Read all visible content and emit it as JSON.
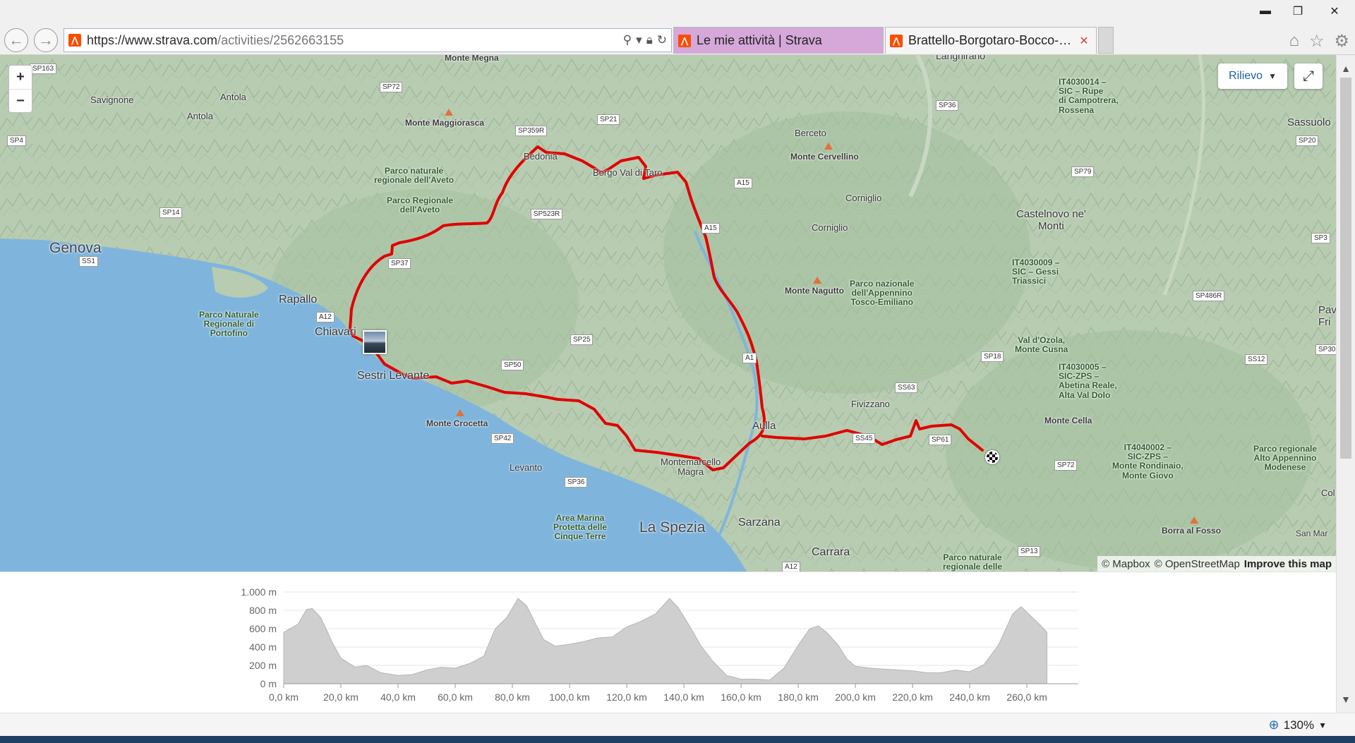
{
  "browser": {
    "url_host": "https://www.strava.com",
    "url_path": "/activities/2562663155",
    "tabs": [
      {
        "title": "Le mie attività | Strava"
      },
      {
        "title": "Brattello-Borgotaro-Bocco-C..."
      }
    ],
    "zoom": "130%"
  },
  "map": {
    "relief_label": "Rilievo",
    "zoom_in": "+",
    "zoom_out": "−",
    "attribution": [
      "© Mapbox",
      "© OpenStreetMap",
      "Improve this map"
    ],
    "labels": {
      "monte_megna": "Monte Megna",
      "savignone": "Savignone",
      "antola_1": "Antola",
      "antola_2": "Antola",
      "monte_maggiorasca": "Monte Maggiorasca",
      "bedonia": "Bedonia",
      "borgo_val_di_taro": "Borgo Val di Taro",
      "parco_aveto_1": "Parco naturale\nregionale dell'Aveto",
      "parco_aveto_2": "Parco Regionale\ndell'Aveto",
      "genova": "Genova",
      "rapallo": "Rapallo",
      "chiavari": "Chiavari",
      "parco_portofino": "Parco Naturale\nRegionale di\nPortofino",
      "sestri_levante": "Sestri Levante",
      "monte_crocetta": "Monte Crocetta",
      "levanto": "Levanto",
      "area_marina": "Area Marina\nProtetta delle\nCinque Terre",
      "la_spezia": "La Spezia",
      "sarzana": "Sarzana",
      "carrara": "Carrara",
      "montemarcello_magra": "Montemarcello\nMagra",
      "aulla": "Aulla",
      "fivizzano": "Fivizzano",
      "langhirano": "Langhirano",
      "berceto": "Berceto",
      "monte_cervellino": "Monte Cervellino",
      "corniglio_1": "Corniglio",
      "corniglio_2": "Corniglio",
      "monte_nagutto": "Monte Nagutto",
      "parco_appennino": "Parco nazionale\ndell'Appennino\nTosco-Emiliano",
      "castelnovo": "Castelnovo ne'\nMonti",
      "sic_rupe": "IT4030014 –\nSIC – Rupe\ndi Campotrera,\nRossena",
      "sic_gessi": "IT4030009 –\nSIC – Gessi\nTriassici",
      "val_dozola": "Val d'Ozola,\nMonte Cusna",
      "sic_zps": "IT4030005 –\nSIC-ZPS –\nAbetina Reale,\nAlta Val Dolo",
      "monte_cella": "Monte Cella",
      "sic_zps_2": "IT4040002 –\nSIC-ZPS –\nMonte Rondinaio,\nMonte Giovo",
      "parco_alto_appennino": "Parco regionale\nAlto Appennino\nModenese",
      "borra_al_fosso": "Borra al Fosso",
      "parco_naturale_delle": "Parco naturale\nregionale delle",
      "sassuolo": "Sassuolo",
      "pavullo": "Pav\nFri",
      "col": "Col",
      "san_marco": "San Mar"
    },
    "roads": [
      "SP163",
      "SP72",
      "SP4",
      "SP359R",
      "SP21",
      "SP36",
      "SP20",
      "SP14",
      "SS1",
      "SP37",
      "SP523R",
      "A15",
      "SP79",
      "A15",
      "SP3",
      "A12",
      "SP25",
      "SP50",
      "A1",
      "SP486R",
      "SP18",
      "SS12",
      "SP30",
      "SS63",
      "SP42",
      "SS45",
      "SP36",
      "SP72",
      "SP13",
      "A12",
      "SP61"
    ]
  },
  "elevation": {
    "y_ticks": [
      "1.000 m",
      "800 m",
      "600 m",
      "400 m",
      "200 m",
      "0 m"
    ],
    "x_ticks": [
      "0,0 km",
      "20,0 km",
      "40,0 km",
      "60,0 km",
      "80,0 km",
      "100,0 km",
      "120,0 km",
      "140,0 km",
      "160,0 km",
      "180,0 km",
      "200,0 km",
      "220,0 km",
      "240,0 km",
      "260,0 km"
    ],
    "profile": [
      [
        0,
        560
      ],
      [
        5,
        650
      ],
      [
        8,
        810
      ],
      [
        10,
        820
      ],
      [
        13,
        720
      ],
      [
        17,
        450
      ],
      [
        20,
        280
      ],
      [
        25,
        180
      ],
      [
        29,
        200
      ],
      [
        34,
        120
      ],
      [
        40,
        90
      ],
      [
        45,
        100
      ],
      [
        50,
        150
      ],
      [
        55,
        180
      ],
      [
        60,
        170
      ],
      [
        65,
        220
      ],
      [
        70,
        300
      ],
      [
        74,
        600
      ],
      [
        78,
        720
      ],
      [
        82,
        930
      ],
      [
        85,
        850
      ],
      [
        88,
        660
      ],
      [
        91,
        480
      ],
      [
        95,
        410
      ],
      [
        100,
        430
      ],
      [
        105,
        460
      ],
      [
        110,
        500
      ],
      [
        115,
        510
      ],
      [
        120,
        620
      ],
      [
        125,
        680
      ],
      [
        130,
        760
      ],
      [
        135,
        930
      ],
      [
        138,
        830
      ],
      [
        142,
        630
      ],
      [
        146,
        410
      ],
      [
        150,
        250
      ],
      [
        155,
        90
      ],
      [
        160,
        50
      ],
      [
        165,
        50
      ],
      [
        170,
        40
      ],
      [
        175,
        170
      ],
      [
        180,
        420
      ],
      [
        184,
        600
      ],
      [
        187,
        630
      ],
      [
        190,
        560
      ],
      [
        194,
        420
      ],
      [
        197,
        270
      ],
      [
        200,
        190
      ],
      [
        205,
        170
      ],
      [
        210,
        160
      ],
      [
        215,
        150
      ],
      [
        220,
        140
      ],
      [
        225,
        120
      ],
      [
        230,
        120
      ],
      [
        235,
        150
      ],
      [
        240,
        130
      ],
      [
        245,
        210
      ],
      [
        250,
        420
      ],
      [
        255,
        760
      ],
      [
        258,
        840
      ],
      [
        262,
        720
      ],
      [
        265,
        630
      ],
      [
        267,
        560
      ]
    ]
  },
  "colors": {
    "route": "#e00000",
    "sea": "#7fb5dd",
    "land": "#b7ccb1",
    "elevation_fill": "#cfcfcf",
    "tab_active": "#d5a8d9",
    "brand": "#fc4c02"
  }
}
